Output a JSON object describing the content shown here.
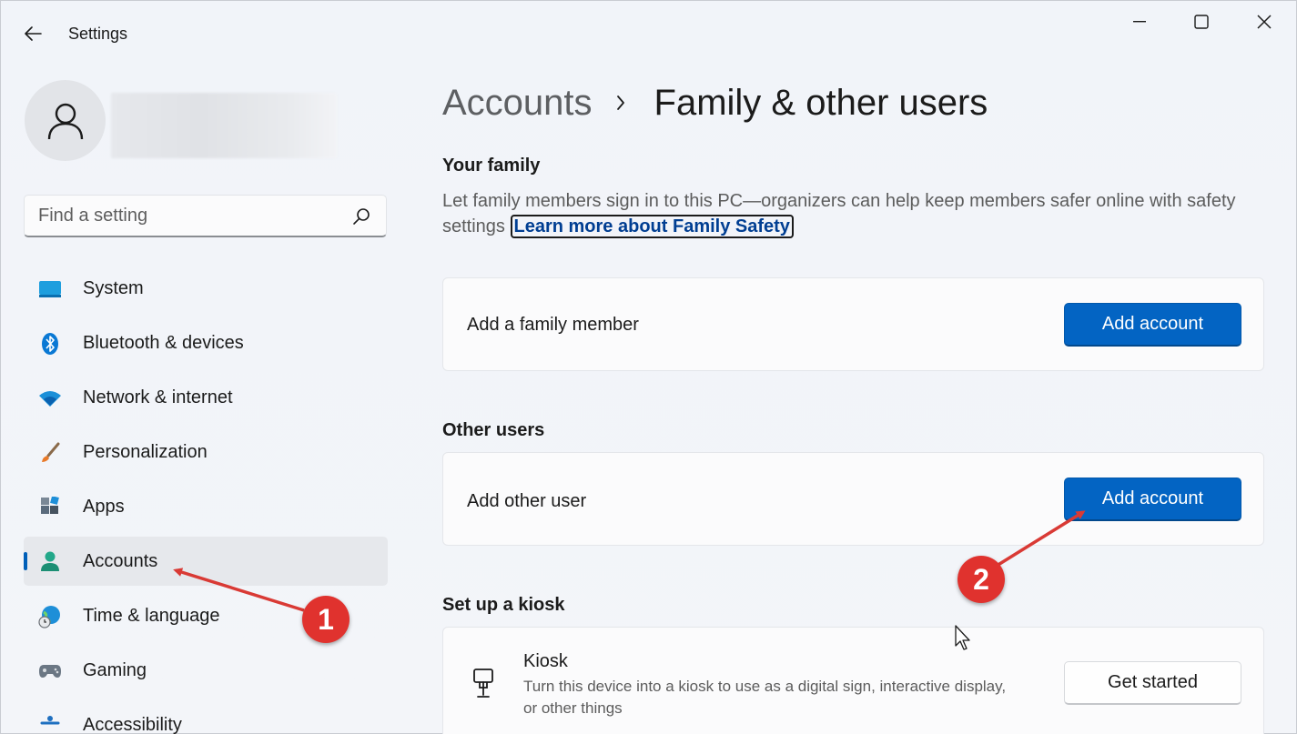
{
  "window": {
    "title": "Settings"
  },
  "sidebar": {
    "search_placeholder": "Find a setting",
    "items": [
      {
        "label": "System",
        "icon": "system-icon",
        "active": false
      },
      {
        "label": "Bluetooth & devices",
        "icon": "bluetooth-icon",
        "active": false
      },
      {
        "label": "Network & internet",
        "icon": "wifi-icon",
        "active": false
      },
      {
        "label": "Personalization",
        "icon": "brush-icon",
        "active": false
      },
      {
        "label": "Apps",
        "icon": "apps-icon",
        "active": false
      },
      {
        "label": "Accounts",
        "icon": "accounts-icon",
        "active": true
      },
      {
        "label": "Time & language",
        "icon": "globe-clock-icon",
        "active": false
      },
      {
        "label": "Gaming",
        "icon": "gamepad-icon",
        "active": false
      },
      {
        "label": "Accessibility",
        "icon": "accessibility-icon",
        "active": false
      }
    ]
  },
  "main": {
    "breadcrumb": {
      "parent": "Accounts",
      "current": "Family & other users"
    },
    "family": {
      "title": "Your family",
      "description": "Let family members sign in to this PC—organizers can help keep members safer online with safety settings",
      "link": "Learn more about Family Safety",
      "card_label": "Add a family member",
      "button": "Add account"
    },
    "other_users": {
      "title": "Other users",
      "card_label": "Add other user",
      "button": "Add account"
    },
    "kiosk": {
      "title": "Set up a kiosk",
      "card_title": "Kiosk",
      "card_description": "Turn this device into a kiosk to use as a digital sign, interactive display, or other things",
      "button": "Get started"
    }
  },
  "annotations": {
    "badge_1": "1",
    "badge_2": "2"
  },
  "colors": {
    "accent": "#0364c3",
    "annotation_red": "#e0322e",
    "link": "#003e92"
  }
}
